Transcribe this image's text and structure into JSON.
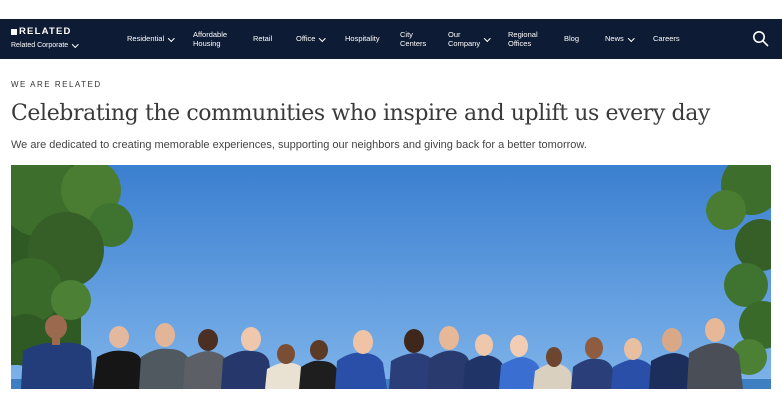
{
  "header": {
    "logo_text": "RELATED",
    "corporate_label": "Related Corporate",
    "nav_items": [
      {
        "label": "Residential",
        "has_dropdown": true
      },
      {
        "label": "Affordable Housing",
        "line1": "Affordable",
        "line2": "Housing",
        "has_dropdown": false
      },
      {
        "label": "Retail",
        "has_dropdown": false
      },
      {
        "label": "Office",
        "has_dropdown": true
      },
      {
        "label": "Hospitality",
        "has_dropdown": false
      },
      {
        "label": "City Centers",
        "line1": "City",
        "line2": "Centers",
        "has_dropdown": false
      },
      {
        "label": "Our Company",
        "line1": "Our",
        "line2": "Company",
        "has_dropdown": true
      },
      {
        "label": "Regional Offices",
        "line1": "Regional",
        "line2": "Offices",
        "has_dropdown": false
      },
      {
        "label": "Blog",
        "has_dropdown": false
      },
      {
        "label": "News",
        "has_dropdown": true
      },
      {
        "label": "Careers",
        "has_dropdown": false
      }
    ],
    "search_icon": "search-icon"
  },
  "main": {
    "eyebrow": "WE ARE RELATED",
    "headline": "Celebrating the communities who inspire and uplift us every day",
    "subheadline": "We are dedicated to creating memorable experiences, supporting our neighbors and giving back for a better tomorrow.",
    "hero_image": "group-photo"
  },
  "colors": {
    "nav_background": "#0e1b35",
    "nav_text": "#ffffff",
    "headline": "#3a3a3a",
    "body_text": "#444444",
    "sky": "#4f8fd6"
  }
}
